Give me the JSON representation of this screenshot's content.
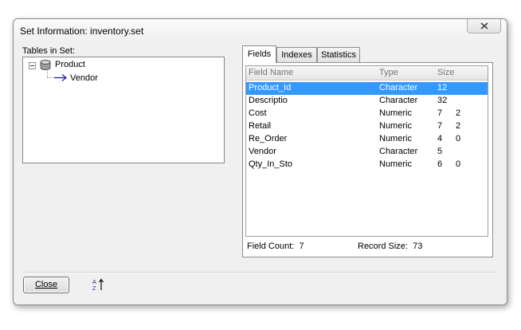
{
  "window": {
    "title": "Set Information: inventory.set"
  },
  "tree": {
    "label": "Tables in Set:",
    "root": "Product",
    "child": "Vendor"
  },
  "tabs": [
    {
      "label": "Fields",
      "active": true
    },
    {
      "label": "Indexes",
      "active": false
    },
    {
      "label": "Statistics",
      "active": false
    }
  ],
  "fields_table": {
    "headers": {
      "name": "Field Name",
      "type": "Type",
      "size": "Size"
    },
    "rows": [
      {
        "name": "Product_Id",
        "type": "Character",
        "size": "12",
        "dec": "",
        "selected": true
      },
      {
        "name": "Descriptio",
        "type": "Character",
        "size": "32",
        "dec": ""
      },
      {
        "name": "Cost",
        "type": "Numeric",
        "size": "7",
        "dec": "2"
      },
      {
        "name": "Retail",
        "type": "Numeric",
        "size": "7",
        "dec": "2"
      },
      {
        "name": "Re_Order",
        "type": "Numeric",
        "size": "4",
        "dec": "0"
      },
      {
        "name": "Vendor",
        "type": "Character",
        "size": "5",
        "dec": ""
      },
      {
        "name": "Qty_In_Sto",
        "type": "Numeric",
        "size": "6",
        "dec": "0"
      }
    ]
  },
  "footer": {
    "field_count_label": "Field Count:",
    "field_count": "7",
    "record_size_label": "Record Size:",
    "record_size": "73"
  },
  "buttons": {
    "close": "Close",
    "sort": "AZ"
  },
  "colors": {
    "selection": "#3399ff",
    "close_x": "#444444"
  }
}
